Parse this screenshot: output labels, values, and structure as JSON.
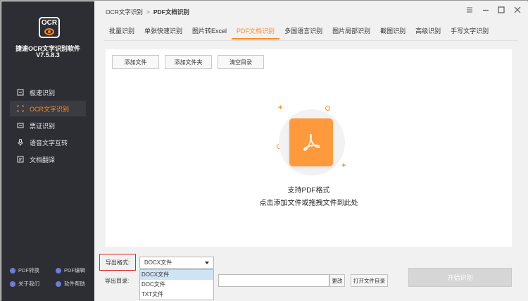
{
  "app": {
    "logo_text": "OCR",
    "name": "捷速OCR文字识别软件",
    "version": "V7.5.8.3"
  },
  "sidebar": {
    "items": [
      {
        "label": "极速识别",
        "icon": "scan-icon"
      },
      {
        "label": "OCR文字识别",
        "icon": "ocr-icon",
        "active": true
      },
      {
        "label": "票证识别",
        "icon": "ticket-icon"
      },
      {
        "label": "语音文字互转",
        "icon": "microphone-icon"
      },
      {
        "label": "文档翻译",
        "icon": "translate-icon"
      }
    ],
    "footer": [
      {
        "label": "PDF转换"
      },
      {
        "label": "PDF编辑"
      },
      {
        "label": "关于我们"
      },
      {
        "label": "软件帮助"
      }
    ]
  },
  "breadcrumb": {
    "parent": "OCR文字识别",
    "separator": ">",
    "current": "PDF文档识别"
  },
  "tabs": [
    {
      "label": "批量识别"
    },
    {
      "label": "单张快速识别"
    },
    {
      "label": "图片转Excel"
    },
    {
      "label": "PDF文档识别",
      "active": true
    },
    {
      "label": "多国语言识别"
    },
    {
      "label": "图片局部识别"
    },
    {
      "label": "截图识别"
    },
    {
      "label": "高级识别"
    },
    {
      "label": "手写文字识别"
    }
  ],
  "toolbar": {
    "add_file": "添加文件",
    "add_folder": "添加文件夹",
    "clear_list": "清空目录"
  },
  "dropzone": {
    "support_text": "支持PDF格式",
    "hint_text": "点击添加文件或拖拽文件到此处"
  },
  "export": {
    "format_label": "导出格式:",
    "selected": "DOCX文件",
    "options": [
      "DOCX文件",
      "DOC文件",
      "TXT文件"
    ],
    "dir_label": "导出目录:",
    "change_button": "更改",
    "open_dir_button": "打开文件目录",
    "start_button": "开始识别"
  },
  "colors": {
    "accent": "#ff8a1f",
    "sidebar_bg": "#2c2e34",
    "highlight_border": "#d92b2b",
    "dropdown_selected": "#cfe3f7"
  }
}
